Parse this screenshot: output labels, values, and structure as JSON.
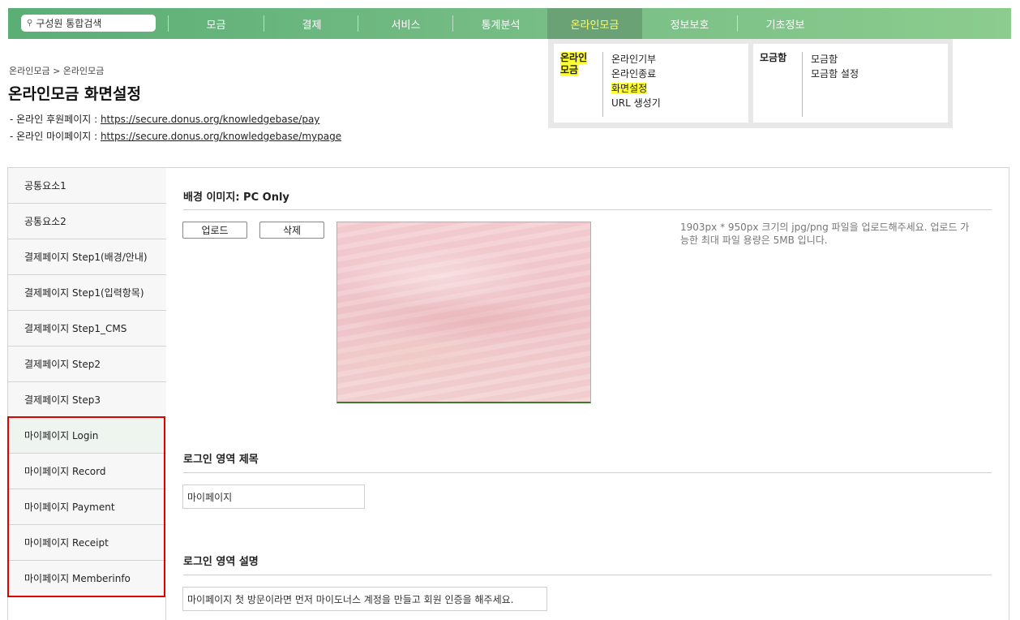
{
  "nav": {
    "search_placeholder": "구성원 통합검색",
    "items": [
      "모금",
      "결제",
      "서비스",
      "통계분석",
      "온라인모금",
      "정보보호",
      "기초정보"
    ]
  },
  "dropdown": {
    "col1_head_line1": "온라인",
    "col1_head_line2": "모금",
    "col1_items": [
      "온라인기부",
      "온라인종료",
      "화면설정",
      "URL 생성기"
    ],
    "col2_head": "모금함",
    "col2_items": [
      "모금함",
      "모금함 설정"
    ]
  },
  "breadcrumb": "온라인모금 > 온라인모금",
  "page_title": "온라인모금 화면설정",
  "links": {
    "donor_prefix": "- 온라인 후원페이지 : ",
    "donor_url": "https://secure.donus.org/knowledgebase/pay",
    "mypage_prefix": "- 온라인 마이페이지 : ",
    "mypage_url": "https://secure.donus.org/knowledgebase/mypage"
  },
  "sidebar": {
    "items": [
      "공통요소1",
      "공통요소2",
      "결제페이지 Step1(배경/안내)",
      "결제페이지 Step1(입력항목)",
      "결제페이지 Step1_CMS",
      "결제페이지 Step2",
      "결제페이지 Step3",
      "마이페이지 Login",
      "마이페이지 Record",
      "마이페이지 Payment",
      "마이페이지 Receipt",
      "마이페이지 Memberinfo"
    ]
  },
  "content": {
    "bg_title": "배경 이미지: PC Only",
    "upload_label": "업로드",
    "delete_label": "삭제",
    "hint": "1903px * 950px 크기의 jpg/png 파일을 업로드해주세요. 업로드 가능한 최대 파일 용량은 5MB 입니다.",
    "login_title_label": "로그인 영역 제목",
    "login_title_value": "마이페이지",
    "login_desc_label": "로그인 영역 설명",
    "login_desc_value": "마이페이지 첫 방문이라면 먼저 마이도너스 계정을 만들고 회원 인증을 해주세요."
  },
  "colors": {
    "nav_green": "#6fb780",
    "active_text": "#ffff66",
    "highlight": "#ffff33",
    "selection_border": "#e00000"
  }
}
